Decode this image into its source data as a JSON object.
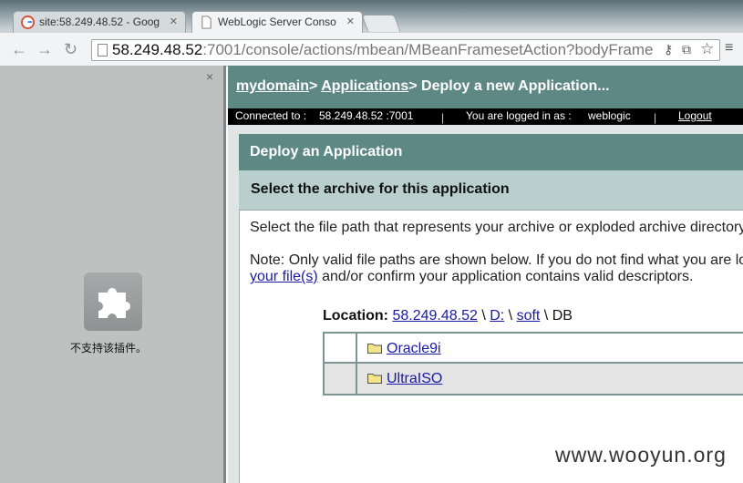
{
  "browser": {
    "tabs": [
      {
        "label": "site:58.249.48.52 - Goog"
      },
      {
        "label": "WebLogic Server Conso"
      }
    ],
    "url_host": "58.249.48.52",
    "url_rest": ":7001/console/actions/mbean/MBeanFramesetAction?bodyFrame"
  },
  "left_frame": {
    "close": "×",
    "plugin_message": "不支持该插件。"
  },
  "console": {
    "breadcrumb": {
      "domain": "mydomain",
      "sep1": "> ",
      "applications": "Applications",
      "sep2": "> ",
      "current": "Deploy a new Application..."
    },
    "status": {
      "connected_label": "Connected to :",
      "connected_value": "58.249.48.52 :7001",
      "logged_label": "You are logged in as :",
      "logged_value": "weblogic",
      "logout": "Logout",
      "sep": "|"
    },
    "panel_title": "Deploy an Application",
    "panel_subtitle": "Select the archive for this application",
    "instruction": "Select the file path that represents your archive or exploded archive directory",
    "note_line1": "Note: Only valid file paths are shown below. If you do not find what you are lo",
    "note_link": "your file(s)",
    "note_line2_rest": " and/or confirm your application contains valid descriptors.",
    "location": {
      "label": "Location:",
      "host": "58.249.48.52",
      "sep": " \\ ",
      "drive": "D:",
      "folder": "soft",
      "current": "DB"
    },
    "files": [
      {
        "name": "Oracle9i"
      },
      {
        "name": "UltraISO"
      }
    ]
  },
  "watermark": "www.wooyun.org"
}
